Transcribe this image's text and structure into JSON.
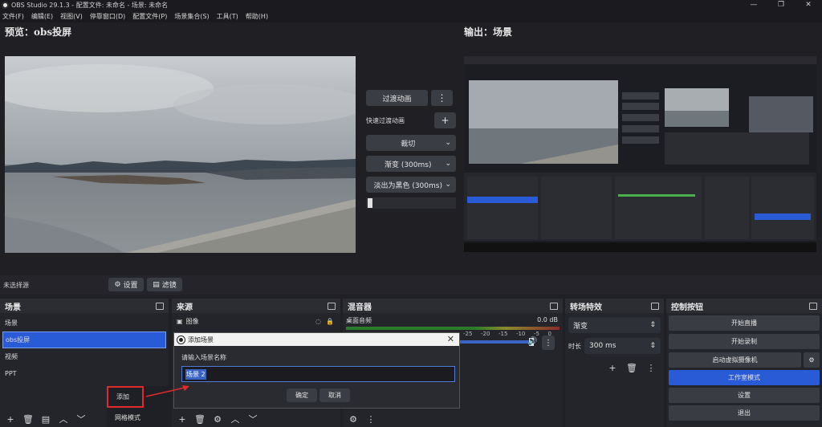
{
  "window": {
    "title": "OBS Studio 29.1.3 - 配置文件: 未命名 - 场景: 未命名",
    "controls": [
      "—",
      "❐",
      "✕"
    ]
  },
  "menu": [
    "文件(F)",
    "编辑(E)",
    "视图(V)",
    "停靠窗口(D)",
    "配置文件(P)",
    "场景集合(S)",
    "工具(T)",
    "帮助(H)"
  ],
  "preview": {
    "label": "预览：obs投屏"
  },
  "output": {
    "label": "输出：场景"
  },
  "transitions": {
    "transition_anim": "过渡动画",
    "quick_transition": "快速过渡动画",
    "cut": "裁切",
    "fade": "渐变 (300ms)",
    "fade_black": "淡出为黑色 (300ms)"
  },
  "source_bar": {
    "no_source": "未选择源",
    "settings": "设置",
    "filters": "滤镜"
  },
  "scenes": {
    "title": "场景",
    "items": [
      "场景",
      "obs投屏",
      "视频",
      "PPT"
    ],
    "selected_index": 1
  },
  "sources": {
    "title": "来源",
    "items": [
      "图像"
    ]
  },
  "mixer": {
    "title": "混音器",
    "channel": "桌面音频",
    "db": "0.0 dB",
    "ticks": [
      "-25",
      "-20",
      "-15",
      "-10",
      "-5",
      "0"
    ]
  },
  "scene_transitions": {
    "title": "转场特效",
    "type": "渐变",
    "duration_label": "时长",
    "duration_value": "300 ms"
  },
  "controls": {
    "title": "控制按钮",
    "start_stream": "开始直播",
    "start_record": "开始录制",
    "virtual_cam": "启动虚拟摄像机",
    "studio_mode": "工作室模式",
    "settings": "设置",
    "exit": "退出"
  },
  "dialog": {
    "title": "添加场景",
    "prompt": "请输入场景名称",
    "value": "场景 2",
    "ok": "确定",
    "cancel": "取消"
  },
  "context_menu": {
    "add": "添加",
    "grid_mode": "网格模式"
  },
  "colors": {
    "accent": "#2a5bd7",
    "background": "#1f1f24",
    "highlight_border": "#e02a2a"
  }
}
